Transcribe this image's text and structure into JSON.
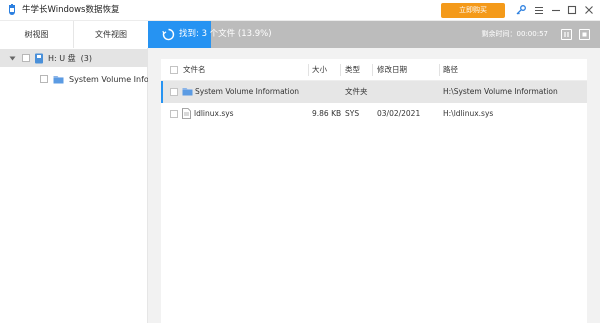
{
  "app": {
    "title": "牛学长Windows数据恢复",
    "buy_label": "立即购买",
    "accent": "#2693f2",
    "buy_color": "#f49a1a"
  },
  "sidebar": {
    "tabs": [
      {
        "label": "树视图"
      },
      {
        "label": "文件视图"
      }
    ],
    "tree": {
      "drive_label": "H: U 盘",
      "drive_count": "(3)",
      "folder_label": "System Volume Information"
    }
  },
  "status": {
    "text": "找到: 3 个文件 (13.9%)",
    "progress": 0.139,
    "timer": "剩余时间：00:00:57"
  },
  "table": {
    "headers": [
      "文件名",
      "大小",
      "类型",
      "修改日期",
      "路径"
    ],
    "rows": [
      {
        "name": "System Volume Information",
        "size": "",
        "type": "文件夹",
        "date": "",
        "path": "H:\\System Volume Information",
        "icon": "folder-icon"
      },
      {
        "name": "ldlinux.sys",
        "size": "9.86 KB",
        "type": "SYS",
        "date": "03/02/2021",
        "path": "H:\\ldlinux.sys",
        "icon": "file-icon"
      }
    ]
  },
  "icons": [
    "app-logo-icon",
    "key-icon",
    "menu-icon",
    "minimize-icon",
    "maximize-icon",
    "close-icon",
    "spinner-icon",
    "pause-icon",
    "stop-icon",
    "drive-icon",
    "folder-icon",
    "file-icon",
    "chevron-down-icon"
  ]
}
